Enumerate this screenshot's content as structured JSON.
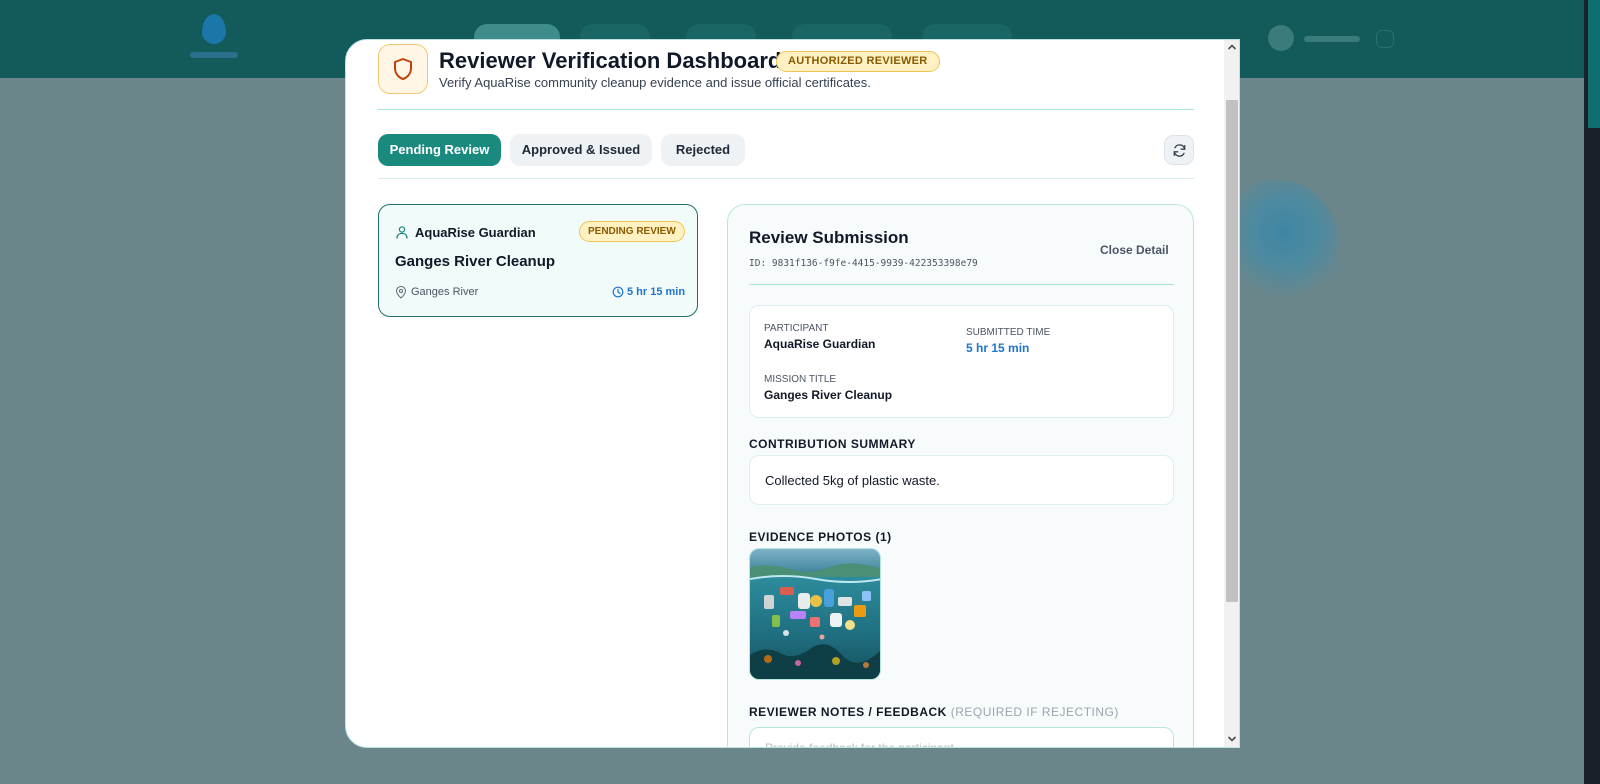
{
  "modal": {
    "title": "Reviewer Verification Dashboard",
    "badge": "AUTHORIZED REVIEWER",
    "subtitle": "Verify AquaRise community cleanup evidence and issue official certificates."
  },
  "tabs": [
    {
      "label": "Pending Review",
      "active": true
    },
    {
      "label": "Approved & Issued",
      "active": false
    },
    {
      "label": "Rejected",
      "active": false
    }
  ],
  "submission": {
    "participant": "AquaRise Guardian",
    "status": "PENDING REVIEW",
    "title": "Ganges River Cleanup",
    "location": "Ganges River",
    "duration": "5 hr 15 min"
  },
  "detail": {
    "title": "Review Submission",
    "close_label": "Close Detail",
    "id_label": "ID: 9831f136-f9fe-4415-9939-422353398e79",
    "participant_label": "PARTICIPANT",
    "participant": "AquaRise Guardian",
    "submitted_label": "SUBMITTED TIME",
    "submitted": "5 hr 15 min",
    "mission_label": "MISSION TITLE",
    "mission": "Ganges River Cleanup",
    "summary_label": "CONTRIBUTION SUMMARY",
    "summary": "Collected 5kg of plastic waste.",
    "photos_label": "EVIDENCE PHOTOS (1)",
    "notes_label": "REVIEWER NOTES / FEEDBACK",
    "notes_hint": "(REQUIRED IF REJECTING)",
    "notes_value": "",
    "notes_placeholder": "Provide feedback for the participant..."
  },
  "colors": {
    "accent": "#1a8a7f",
    "badge_bg": "#fff1c2",
    "time_blue": "#1f74d0"
  }
}
